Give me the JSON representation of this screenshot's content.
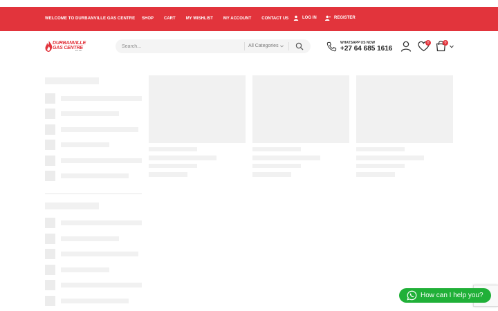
{
  "topbar": {
    "welcome": "WELCOME TO DURBANVILLE GAS CENTRE",
    "nav": [
      "SHOP",
      "CART",
      "MY WISHLIST",
      "MY ACCOUNT",
      "CONTACT US"
    ],
    "login": "LOG IN",
    "register": "REGISTER",
    "background": "#e2343c"
  },
  "logo": {
    "line1": "DURBANVILLE",
    "line2": "GAS CENTRE",
    "sub": "EST. 2002"
  },
  "search": {
    "placeholder": "Search...",
    "category": "All Categories",
    "search_icon": "search-icon"
  },
  "contact": {
    "label": "WHATSAPP US NOW",
    "number": "+27 64 685 1616",
    "icon": "phone-icon"
  },
  "header_icons": {
    "account": "user-icon",
    "wishlist": "heart-icon",
    "wishlist_count": "0",
    "cart": "cart-icon",
    "cart_count": "0"
  },
  "chat": {
    "label": "How can I help you?",
    "icon": "whatsapp-icon",
    "color": "#20b038"
  },
  "colors": {
    "accent": "#e2343c",
    "skeleton": "#f1f1f1"
  }
}
